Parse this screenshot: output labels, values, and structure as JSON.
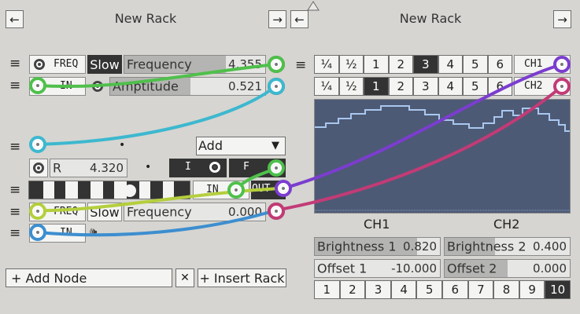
{
  "left_rack": {
    "title": "New Rack",
    "back_arrow": "←",
    "forward_arrow": "→"
  },
  "right_rack": {
    "title": "New Rack",
    "back_arrow": "←",
    "forward_arrow": "→"
  },
  "handle_glyph": "≡",
  "lfo1": {
    "freq_label": "FREQ",
    "slow_label": "Slow",
    "frequency_label": "Frequency",
    "frequency_value": "4.355",
    "frequency_fill": 0.72,
    "in_label": "IN",
    "amplitude_label": "Amptitude",
    "amplitude_value": "0.521",
    "amplitude_fill": 0.52
  },
  "mixer": {
    "dot": "•",
    "mode_value": "Add",
    "dropdown_arrow": "▼"
  },
  "register": {
    "name": "R",
    "value": "4.320",
    "dot": "•",
    "i_label": "I",
    "f_label": "F"
  },
  "seq": {
    "in_label": "IN",
    "out_label": "OUT"
  },
  "lfo2": {
    "freq_label": "FREQ",
    "slow_label": "Slow",
    "frequency_label": "Frequency",
    "frequency_value": "0.000",
    "frequency_fill": 0.0,
    "in_label": "IN",
    "speaker_glyph": "🕪"
  },
  "footer": {
    "add_node": "+ Add Node",
    "close": "✕",
    "insert_rack": "+ Insert Rack"
  },
  "scope": {
    "ch1_rates": [
      "¼",
      "½",
      "1",
      "2",
      "3",
      "4",
      "5",
      "6"
    ],
    "ch1_selected": 4,
    "ch2_rates": [
      "¼",
      "½",
      "1",
      "2",
      "3",
      "4",
      "5",
      "6"
    ],
    "ch2_selected": 2,
    "ch1_label": "CH1",
    "ch2_label": "CH2",
    "ch1_caption": "CH1",
    "ch2_caption": "CH2",
    "brightness1_label": "Brightness 1",
    "brightness1_value": "0.820",
    "brightness1_fill": 0.82,
    "brightness2_label": "Brightness 2",
    "brightness2_value": "0.400",
    "brightness2_fill": 0.4,
    "offset1_label": "Offset 1",
    "offset1_value": "-10.000",
    "offset1_fill": 0.0,
    "offset2_label": "Offset 2",
    "offset2_value": "0.000",
    "offset2_fill": 0.5,
    "pages": [
      "1",
      "2",
      "3",
      "4",
      "5",
      "6",
      "7",
      "8",
      "9",
      "10"
    ],
    "page_selected": 9
  },
  "colors": {
    "green": "#4fc04b",
    "cyan": "#3db8cf",
    "purple": "#7b3dcf",
    "pink": "#c23b76",
    "lime": "#b4cf3d",
    "blue": "#3d8ecf",
    "scope_bg": "#4d5a75",
    "scope_line": "#a9c7ef"
  }
}
